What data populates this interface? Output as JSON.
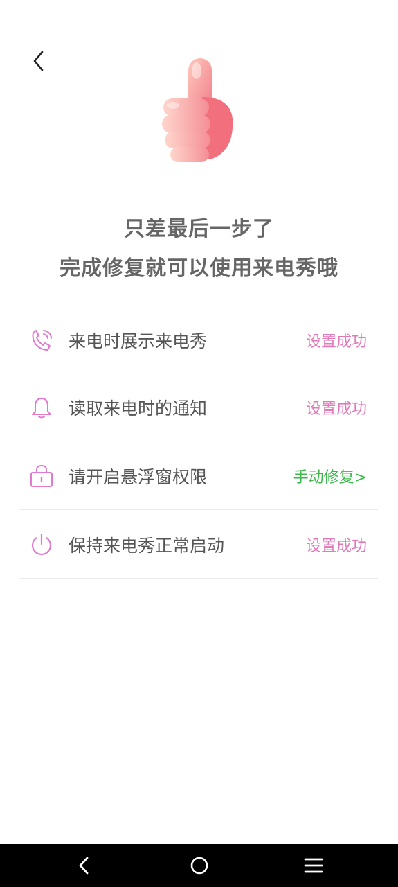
{
  "header": {
    "back_icon": "chevron-left-icon",
    "hero_icon": "thumbs-up-icon"
  },
  "headline": {
    "line1": "只差最后一步了",
    "line2": "完成修复就可以使用来电秀哦"
  },
  "permissions": [
    {
      "icon": "phone-icon",
      "label": "来电时展示来电秀",
      "status": "设置成功"
    },
    {
      "icon": "bell-icon",
      "label": "读取来电时的通知",
      "status": "设置成功"
    },
    {
      "icon": "lock-icon",
      "label": "请开启悬浮窗权限",
      "status": "手动修复>"
    },
    {
      "icon": "power-icon",
      "label": "保持来电秀正常启动",
      "status": "设置成功"
    }
  ],
  "navbar": {
    "back_icon": "nav-back-icon",
    "home_icon": "nav-home-icon",
    "menu_icon": "nav-menu-icon"
  },
  "colors": {
    "accent": "#e07ab8",
    "icon": "#e07ad0",
    "fix": "#3bb84a",
    "headline": "#666666",
    "label": "#555555"
  }
}
